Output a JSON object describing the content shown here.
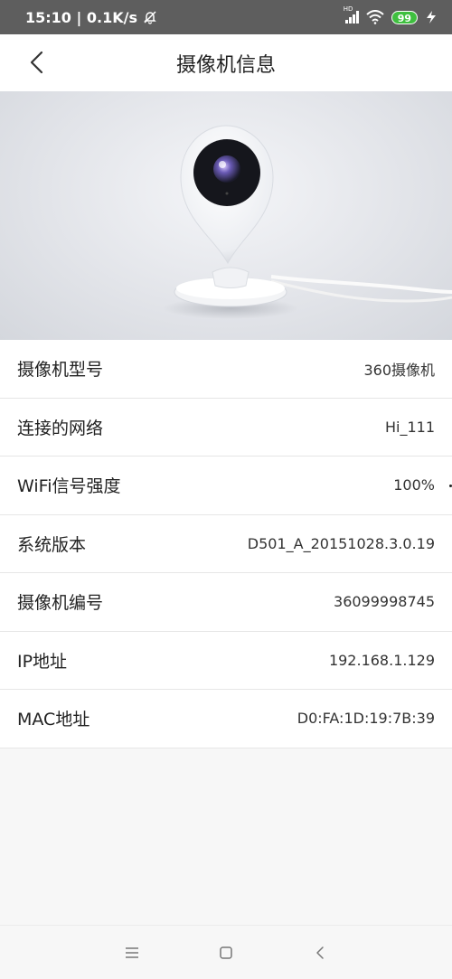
{
  "status_bar": {
    "time_speed": "15:10 | 0.1K/s",
    "network_badge": "HD",
    "battery": "99"
  },
  "header": {
    "title": "摄像机信息"
  },
  "info_rows": [
    {
      "label": "摄像机型号",
      "value": "360摄像机"
    },
    {
      "label": "连接的网络",
      "value": "Hi_111"
    },
    {
      "label": "WiFi信号强度",
      "value": "100%"
    },
    {
      "label": "系统版本",
      "value": "D501_A_20151028.3.0.19"
    },
    {
      "label": "摄像机编号",
      "value": "36099998745"
    },
    {
      "label": "IP地址",
      "value": "192.168.1.129"
    },
    {
      "label": "MAC地址",
      "value": "D0:FA:1D:19:7B:39"
    }
  ],
  "icons": {
    "back": "chevron-left-icon",
    "mute": "bell-off-icon",
    "wifi": "wifi-icon",
    "charging": "lightning-icon",
    "menu": "menu-icon",
    "home": "square-icon",
    "nav_back": "chevron-left-icon"
  },
  "colors": {
    "status_bar": "#5e5e5e",
    "battery": "#3fbf3f",
    "header_bg": "#ffffff"
  }
}
